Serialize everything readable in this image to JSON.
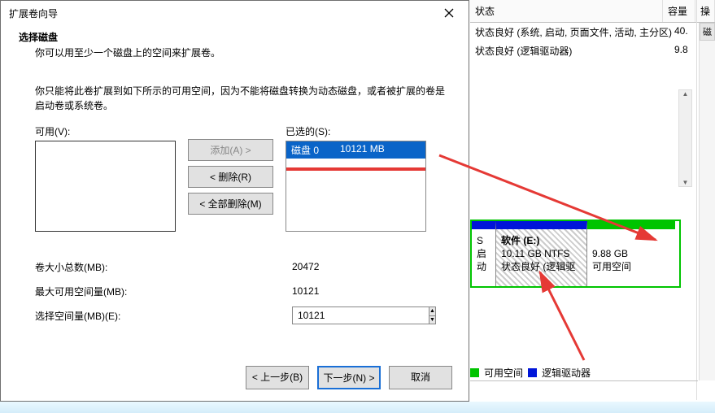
{
  "dialog": {
    "title": "扩展卷向导",
    "section_title": "选择磁盘",
    "section_sub": "你可以用至少一个磁盘上的空间来扩展卷。",
    "desc": "你只能将此卷扩展到如下所示的可用空间，因为不能将磁盘转换为动态磁盘，或者被扩展的卷是启动卷或系统卷。",
    "available_label": "可用(V):",
    "selected_label": "已选的(S):",
    "buttons": {
      "add": "添加(A) >",
      "remove": "< 删除(R)",
      "remove_all": "< 全部删除(M)"
    },
    "selected_item": {
      "disk": "磁盘 0",
      "size": "10121 MB"
    },
    "fields": {
      "total_label": "卷大小总数(MB):",
      "total_value": "20472",
      "max_label": "最大可用空间量(MB):",
      "max_value": "10121",
      "sel_label": "选择空间量(MB)(E):",
      "sel_value": "10121"
    },
    "footer": {
      "back": "< 上一步(B)",
      "next": "下一步(N) >",
      "cancel": "取消"
    }
  },
  "bg": {
    "cols": {
      "status": "状态",
      "capacity": "容量",
      "ops": "操"
    },
    "rows": [
      {
        "status": "状态良好 (系统, 启动, 页面文件, 活动, 主分区)",
        "cap": "40."
      },
      {
        "status": "状态良好 (逻辑驱动器)",
        "cap": "9.8"
      }
    ],
    "sidebar_tab": "磁",
    "partitions": {
      "sys": {
        "line1": "S",
        "line2": "启动"
      },
      "soft": {
        "title": "软件  (E:)",
        "line1": "10.11 GB NTFS",
        "line2": "状态良好 (逻辑驱"
      },
      "free": {
        "line1": "9.88 GB",
        "line2": "可用空间"
      }
    },
    "legend": {
      "free": "可用空间",
      "logical": "逻辑驱动器"
    }
  }
}
